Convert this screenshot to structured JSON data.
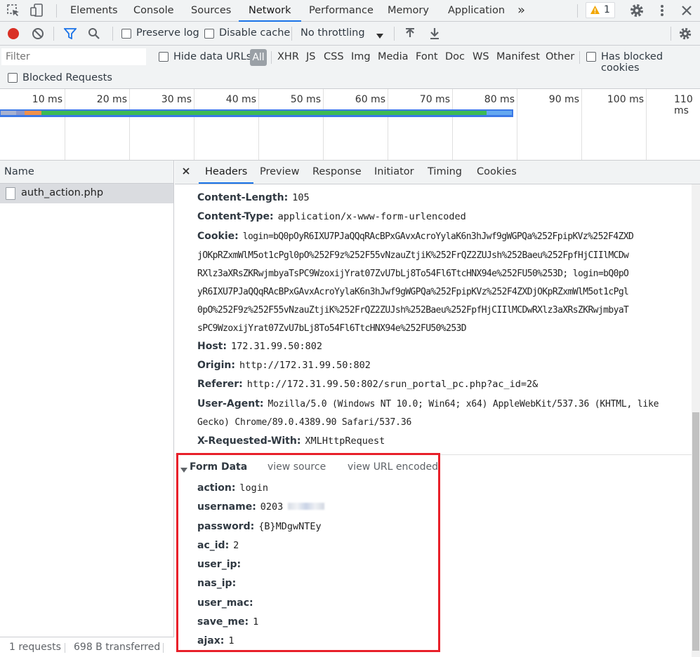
{
  "topbar": {
    "tabs": [
      "Elements",
      "Console",
      "Sources",
      "Network",
      "Performance",
      "Memory",
      "Application"
    ],
    "active_tab": "Network",
    "more": "»",
    "warning_count": "1"
  },
  "toolbar": {
    "preserve_log": "Preserve log",
    "disable_cache": "Disable cache",
    "throttling": "No throttling"
  },
  "filter": {
    "placeholder": "Filter",
    "hide_data_urls": "Hide data URLs",
    "all": "All",
    "types": [
      "XHR",
      "JS",
      "CSS",
      "Img",
      "Media",
      "Font",
      "Doc",
      "WS",
      "Manifest",
      "Other"
    ],
    "has_blocked_cookies": "Has blocked cookies",
    "blocked_requests": "Blocked Requests"
  },
  "overview": {
    "ticks": [
      "10 ms",
      "20 ms",
      "30 ms",
      "40 ms",
      "50 ms",
      "60 ms",
      "70 ms",
      "80 ms",
      "90 ms",
      "100 ms",
      "110 ms"
    ]
  },
  "requests": {
    "header": "Name",
    "items": [
      "auth_action.php"
    ],
    "status_requests": "1 requests",
    "status_transferred": "698 B transferred"
  },
  "details": {
    "tabs": [
      "Headers",
      "Preview",
      "Response",
      "Initiator",
      "Timing",
      "Cookies"
    ],
    "active_tab": "Headers",
    "headers": {
      "content_length_key": "Content-Length:",
      "content_length": "105",
      "content_type_key": "Content-Type:",
      "content_type": "application/x-www-form-urlencoded",
      "cookie_key": "Cookie:",
      "cookie_lines": [
        "login=bQ0pOyR6IXU7PJaQQqRAcBPxGAvxAcroYylaK6n3hJwf9gWGPQa%252FpipKVz%252F4ZXD",
        "jOKpRZxmWlM5ot1cPgl0pO%252F9z%252F55vNzauZtjiK%252FrQZ2ZUJsh%252Baeu%252FpfHjCIIlMCDw",
        "RXlz3aXRsZKRwjmbyaTsPC9WzoxijYrat07ZvU7bLj8To54Fl6TtcHNX94e%252FU50%253D; login=bQ0pO",
        "yR6IXU7PJaQQqRAcBPxGAvxAcroYylaK6n3hJwf9gWGPQa%252FpipKVz%252F4ZXDjOKpRZxmWlM5ot1cPgl",
        "0pO%252F9z%252F55vNzauZtjiK%252FrQZ2ZUJsh%252Baeu%252FpfHjCIIlMCDwRXlz3aXRsZKRwjmbyaT",
        "sPC9WzoxijYrat07ZvU7bLj8To54Fl6TtcHNX94e%252FU50%253D"
      ],
      "host_key": "Host:",
      "host": "172.31.99.50:802",
      "origin_key": "Origin:",
      "origin": "http://172.31.99.50:802",
      "referer_key": "Referer:",
      "referer": "http://172.31.99.50:802/srun_portal_pc.php?ac_id=2&",
      "user_agent_key": "User-Agent:",
      "user_agent_1": "Mozilla/5.0 (Windows NT 10.0; Win64; x64) AppleWebKit/537.36 (KHTML, like",
      "user_agent_2": "Gecko) Chrome/89.0.4389.90 Safari/537.36",
      "xrw_key": "X-Requested-With:",
      "xrw": "XMLHttpRequest"
    },
    "form_data": {
      "title": "Form Data",
      "view_source": "view source",
      "view_url_encoded": "view URL encoded",
      "fields": [
        {
          "key": "action:",
          "value": "login"
        },
        {
          "key": "username:",
          "value": "0203"
        },
        {
          "key": "password:",
          "value": "{B}MDgwNTEy"
        },
        {
          "key": "ac_id:",
          "value": "2"
        },
        {
          "key": "user_ip:",
          "value": ""
        },
        {
          "key": "nas_ip:",
          "value": ""
        },
        {
          "key": "user_mac:",
          "value": ""
        },
        {
          "key": "save_me:",
          "value": "1"
        },
        {
          "key": "ajax:",
          "value": "1"
        }
      ]
    }
  },
  "colors": {
    "accent": "#1a73e8",
    "record": "#d93025",
    "highlight": "#e8202a",
    "waterfall_green": "#3cba54",
    "waterfall_blue": "#3b78e7"
  }
}
